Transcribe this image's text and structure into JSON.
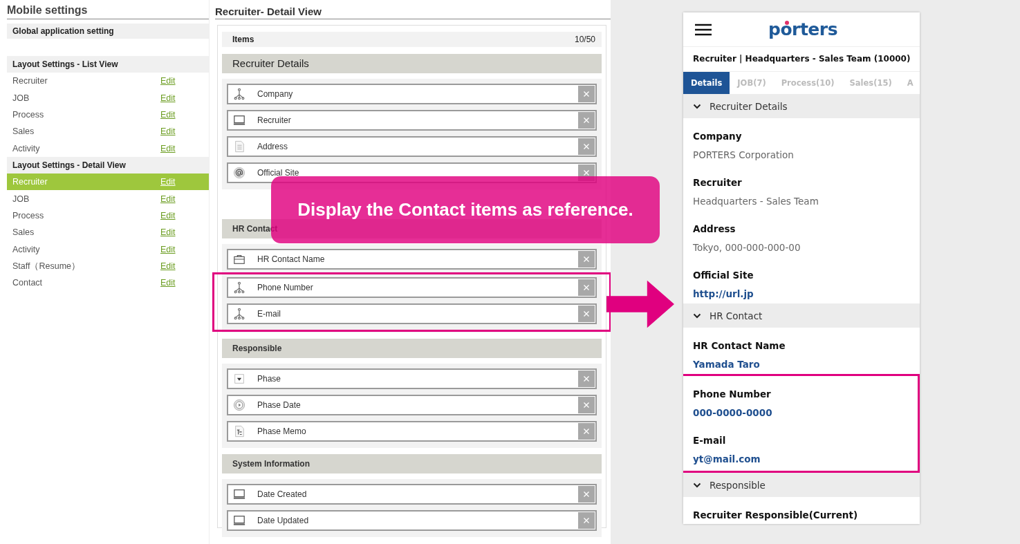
{
  "settings": {
    "title": "Mobile settings",
    "global_setting": {
      "label": "Global application setting"
    },
    "groups": [
      {
        "title": "Layout Settings - List View",
        "rows": [
          {
            "label": "Recruiter",
            "link": "Edit",
            "selected": false
          },
          {
            "label": "JOB",
            "link": "Edit",
            "selected": false
          },
          {
            "label": "Process",
            "link": "Edit",
            "selected": false
          },
          {
            "label": "Sales",
            "link": "Edit",
            "selected": false
          },
          {
            "label": "Activity",
            "link": "Edit",
            "selected": false
          }
        ]
      },
      {
        "title": "Layout Settings - Detail View",
        "rows": [
          {
            "label": "Recruiter",
            "link": "Edit",
            "selected": true
          },
          {
            "label": "JOB",
            "link": "Edit",
            "selected": false
          },
          {
            "label": "Process",
            "link": "Edit",
            "selected": false
          },
          {
            "label": "Sales",
            "link": "Edit",
            "selected": false
          },
          {
            "label": "Activity",
            "link": "Edit",
            "selected": false
          },
          {
            "label": "Staff（Resume）",
            "link": "Edit",
            "selected": false
          },
          {
            "label": "Contact",
            "link": "Edit",
            "selected": false
          }
        ]
      }
    ]
  },
  "detail_view": {
    "title": "Recruiter- Detail View",
    "items": {
      "label": "Items",
      "count": "10/50"
    },
    "sections": [
      {
        "title": "Recruiter Details",
        "kind": "main",
        "fields": [
          {
            "label": "Company",
            "kind": "tree"
          },
          {
            "label": "Recruiter",
            "kind": "monitor"
          },
          {
            "label": "Address",
            "kind": "document"
          },
          {
            "label": "Official Site",
            "kind": "at"
          }
        ]
      },
      {
        "title": "HR Contact",
        "kind": "sub",
        "fields": [
          {
            "label": "HR Contact Name",
            "kind": "briefcase"
          }
        ],
        "highlighted_fields": [
          {
            "label": "Phone Number",
            "kind": "tree"
          },
          {
            "label": "E-mail",
            "kind": "tree"
          }
        ]
      },
      {
        "title": "Responsible",
        "kind": "sub",
        "fields": [
          {
            "label": "Phase",
            "kind": "dropdown"
          },
          {
            "label": "Phase Date",
            "kind": "clock"
          },
          {
            "label": "Phase Memo",
            "kind": "memo"
          }
        ]
      },
      {
        "title": "System Information",
        "kind": "sub",
        "fields": [
          {
            "label": "Date Created",
            "kind": "monitor"
          },
          {
            "label": "Date Updated",
            "kind": "monitor"
          }
        ]
      }
    ]
  },
  "callout": {
    "text": "Display the Contact items as reference."
  },
  "phone": {
    "logo": "porters",
    "record_title": "Recruiter | Headquarters - Sales Team (10000)",
    "tabs": [
      {
        "label": "Details",
        "selected": true
      },
      {
        "label": "JOB(7)",
        "selected": false
      },
      {
        "label": "Process(10)",
        "selected": false
      },
      {
        "label": "Sales(15)",
        "selected": false
      },
      {
        "label": "A",
        "selected": false
      }
    ],
    "sections": [
      {
        "title": "Recruiter Details",
        "fields": [
          {
            "label": "Company",
            "value": "PORTERS Corporation",
            "link": false
          },
          {
            "label": "Recruiter",
            "value": "Headquarters - Sales Team",
            "link": false
          },
          {
            "label": "Address",
            "value": "Tokyo, 000-000-000-00",
            "link": false
          },
          {
            "label": "Official Site",
            "value": "http://url.jp",
            "link": true
          }
        ]
      },
      {
        "title": "HR Contact",
        "fields": [
          {
            "label": "HR Contact Name",
            "value": "Yamada Taro",
            "link": true
          }
        ],
        "highlighted_fields": [
          {
            "label": "Phone Number",
            "value": "000-0000-0000",
            "link": true
          },
          {
            "label": "E-mail",
            "value": "yt@mail.com",
            "link": true
          }
        ]
      },
      {
        "title": "Responsible",
        "fields": [
          {
            "label": "Recruiter Responsible(Current)"
          }
        ]
      }
    ]
  }
}
